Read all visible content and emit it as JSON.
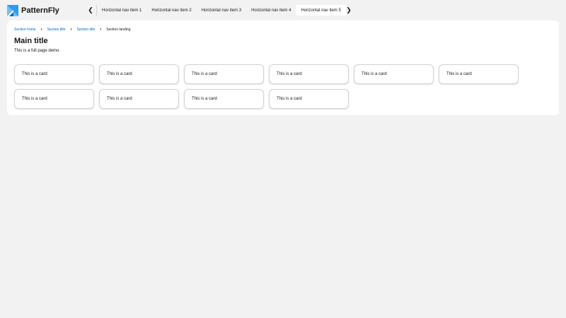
{
  "brand": {
    "name": "PatternFly"
  },
  "nav": {
    "items": [
      {
        "label": "Horizontal nav item 1",
        "active": false
      },
      {
        "label": "Horizontal nav item 2",
        "active": false
      },
      {
        "label": "Horizontal nav item 3",
        "active": false
      },
      {
        "label": "Horizontal nav item 4",
        "active": false
      },
      {
        "label": "Horizontal nav item 5",
        "active": true
      }
    ]
  },
  "breadcrumb": [
    {
      "label": "Section home",
      "link": true
    },
    {
      "label": "Section title",
      "link": true
    },
    {
      "label": "Section title",
      "link": true
    },
    {
      "label": "Section landing",
      "link": false
    }
  ],
  "main": {
    "title": "Main title",
    "description": "This is a full page demo."
  },
  "cards": [
    "This is a card",
    "This is a card",
    "This is a card",
    "This is a card",
    "This is a card",
    "This is a card",
    "This is a card",
    "This is a card",
    "This is a card",
    "This is a card"
  ],
  "colors": {
    "link": "#0066cc",
    "page_bg": "#f2f2f2",
    "logo_dark": "#1e5fb5",
    "logo_light": "#73bcf7"
  }
}
